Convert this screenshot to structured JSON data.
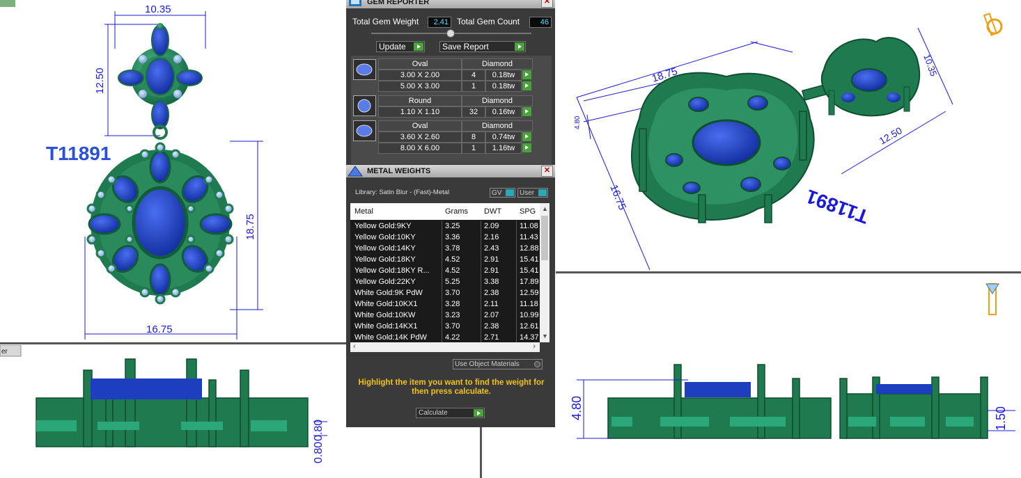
{
  "views": {
    "top_left": {
      "dims": {
        "top_width": "10.35",
        "top_height": "12.50",
        "bottom_height": "18.75",
        "bottom_width": "16.75"
      },
      "label": "T11891"
    },
    "top_right": {
      "dims": {
        "a": "18.75",
        "b": "10.35",
        "c": "12.50",
        "d": "16.75",
        "e": "4.80"
      },
      "label": "T11891"
    },
    "bottom_left": {
      "dims": {
        "a": "0.80",
        "b": "0.80"
      },
      "corner_label": "er"
    },
    "bottom_right": {
      "dims": {
        "a": "4.80",
        "b": "1.50"
      }
    }
  },
  "gem_reporter": {
    "title": "GEM REPORTER",
    "total_weight_label": "Total Gem Weight",
    "total_weight_value": "2.41",
    "total_count_label": "Total Gem Count",
    "total_count_value": "46",
    "update_label": "Update",
    "save_label": "Save Report",
    "groups": [
      {
        "shape": "Oval",
        "material": "Diamond",
        "rows": [
          {
            "size": "3.00 X 2.00",
            "count": "4",
            "weight": "0.18tw"
          },
          {
            "size": "5.00 X 3.00",
            "count": "1",
            "weight": "0.18tw"
          }
        ]
      },
      {
        "shape": "Round",
        "material": "Diamond",
        "rows": [
          {
            "size": "1.10 X 1.10",
            "count": "32",
            "weight": "0.16tw"
          }
        ]
      },
      {
        "shape": "Oval",
        "material": "Diamond",
        "rows": [
          {
            "size": "3.60 X 2.60",
            "count": "8",
            "weight": "0.74tw"
          },
          {
            "size": "8.00 X 6.00",
            "count": "1",
            "weight": "1.16tw"
          }
        ]
      }
    ]
  },
  "metal_weights": {
    "title": "METAL WEIGHTS",
    "library": "Library: Satin Blur - (Fast)-Metal",
    "gv_label": "GV",
    "user_label": "User",
    "columns": [
      "Metal",
      "Grams",
      "DWT",
      "SPG"
    ],
    "rows": [
      [
        "Yellow Gold:9KY",
        "3.25",
        "2.09",
        "11.08"
      ],
      [
        "Yellow Gold:10KY",
        "3.36",
        "2.16",
        "11.43"
      ],
      [
        "Yellow Gold:14KY",
        "3.78",
        "2.43",
        "12.88"
      ],
      [
        "Yellow Gold:18KY",
        "4.52",
        "2.91",
        "15.41"
      ],
      [
        "Yellow Gold:18KY R...",
        "4.52",
        "2.91",
        "15.41"
      ],
      [
        "Yellow Gold:22KY",
        "5.25",
        "3.38",
        "17.89"
      ],
      [
        "White Gold:9K PdW",
        "3.70",
        "2.38",
        "12.59"
      ],
      [
        "White Gold:10KX1",
        "3.28",
        "2.11",
        "11.18"
      ],
      [
        "White Gold:10KW",
        "3.23",
        "2.07",
        "10.99"
      ],
      [
        "White Gold:14KX1",
        "3.70",
        "2.38",
        "12.61"
      ],
      [
        "White Gold:14K PdW",
        "4.22",
        "2.71",
        "14.37"
      ]
    ],
    "use_object_materials": "Use Object Materials",
    "hint": "Highlight the item you want to find the weight for then press calculate.",
    "calculate_label": "Calculate"
  },
  "colors": {
    "metal": "#1f7a4f",
    "gem": "#1d3fbf",
    "dim": "#1a1ad8",
    "panel": "#3a3a3a",
    "accent": "#49a23a",
    "hint": "#f3c21a"
  }
}
